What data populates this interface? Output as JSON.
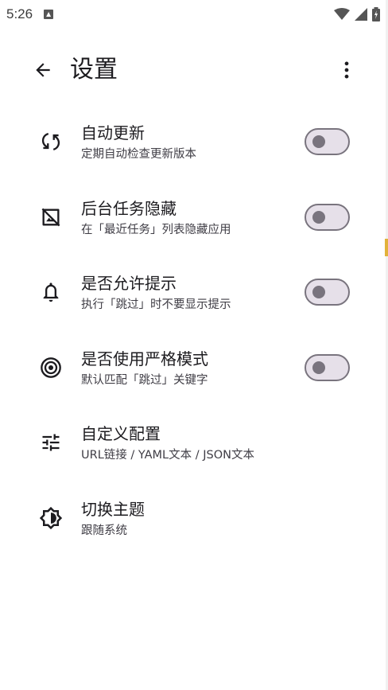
{
  "status_bar": {
    "time": "5:26",
    "icons": [
      "notification-icon",
      "wifi-icon",
      "cellular-icon",
      "battery-icon"
    ]
  },
  "app_bar": {
    "title": "设置",
    "back_icon": "arrow-back-icon",
    "more_icon": "more-vert-icon"
  },
  "settings": [
    {
      "icon": "sync-icon",
      "title": "自动更新",
      "subtitle": "定期自动检查更新版本",
      "toggle": false
    },
    {
      "icon": "hide-image-icon",
      "title": "后台任务隐藏",
      "subtitle": "在「最近任务」列表隐藏应用",
      "toggle": false
    },
    {
      "icon": "bell-icon",
      "title": "是否允许提示",
      "subtitle": "执行「跳过」时不要显示提示",
      "toggle": false
    },
    {
      "icon": "target-icon",
      "title": "是否使用严格模式",
      "subtitle": "默认匹配「跳过」关键字",
      "toggle": false
    },
    {
      "icon": "tune-icon",
      "title": "自定义配置",
      "subtitle": "URL链接 / YAML文本 / JSON文本"
    },
    {
      "icon": "brightness-icon",
      "title": "切换主题",
      "subtitle": "跟随系统"
    }
  ],
  "colors": {
    "text_primary": "#1c1b1f",
    "text_secondary": "#3f3d45",
    "toggle_outline": "#79747e",
    "toggle_track": "#e6e0e9"
  }
}
